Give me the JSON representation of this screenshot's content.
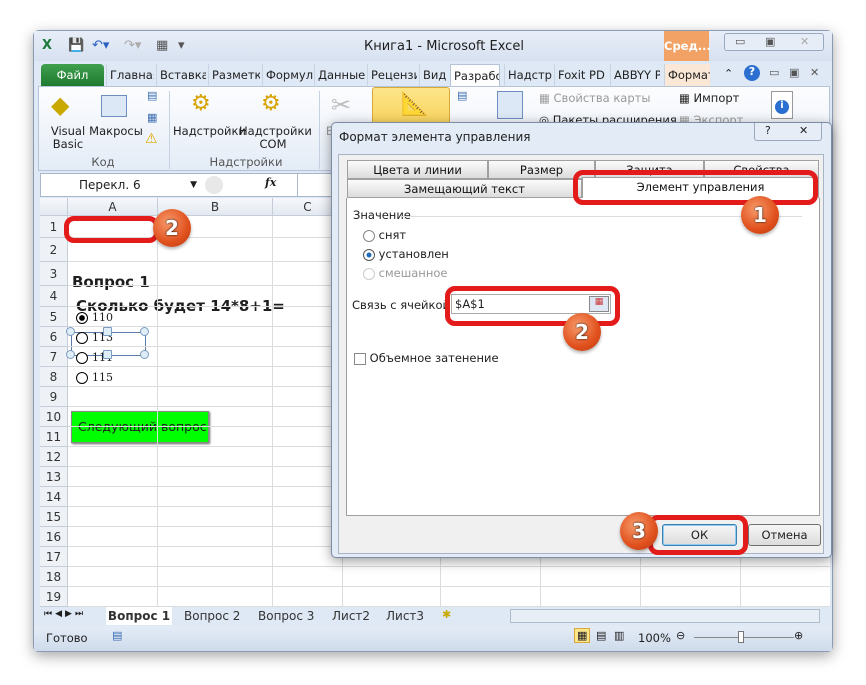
{
  "window": {
    "title": "Книга1  -  Microsoft Excel",
    "contextual_tab": "Сред...",
    "contextual_color": "#f1a264"
  },
  "ribbon_tabs": [
    "Файл",
    "Главная",
    "Вставка",
    "Разметк",
    "Формул",
    "Данные",
    "Рецензи",
    "Вид",
    "Разрабо",
    "Надстро",
    "Foxit PD",
    "ABBYY PI",
    "Формат"
  ],
  "active_tab": "Разрабо",
  "ribbon": {
    "code_group": {
      "label": "Код",
      "visual_basic": "Visual Basic",
      "macros": "Макросы"
    },
    "addins_group": {
      "label": "Надстройки",
      "addins": "Надстройки",
      "com_addins": "Надстройки COM"
    },
    "map_properties": "Свойства карты",
    "expansion_packs": "Пакеты расширения",
    "import": "Импорт",
    "export": "Экспорт",
    "insert_partial": "Вс"
  },
  "formula_bar": {
    "name_box": "Перекл. 6",
    "fx": "fx",
    "value": ""
  },
  "sheet": {
    "columns": [
      "A",
      "B",
      "C"
    ],
    "rows": [
      "1",
      "2",
      "3",
      "4",
      "5",
      "6",
      "7",
      "8",
      "9",
      "10",
      "11",
      "12",
      "13",
      "14",
      "15",
      "16",
      "17",
      "18",
      "19"
    ],
    "cells": {
      "A2": "Вопрос 1",
      "A3": "Сколько будет 14*8+1="
    },
    "options": [
      {
        "label": "110",
        "selected": true
      },
      {
        "label": "113",
        "selected": false
      },
      {
        "label": "111",
        "selected": false
      },
      {
        "label": "115",
        "selected": false
      }
    ],
    "next_button": "Следующий вопрос",
    "next_button_color": "#00ff00"
  },
  "sheet_tabs": [
    "Вопрос 1",
    "Вопрос 2",
    "Вопрос 3",
    "Лист2",
    "Лист3"
  ],
  "active_sheet": "Вопрос 1",
  "status": {
    "ready": "Готово",
    "zoom": "100%",
    "zoom_level": 100
  },
  "dialog": {
    "title": "Формат элемента управления",
    "tabs_row1": [
      "Цвета и линии",
      "Размер",
      "Защита",
      "Свойства"
    ],
    "tabs_row2": [
      "Замещающий текст",
      "Элемент управления"
    ],
    "active_tab": "Элемент управления",
    "value_group": "Значение",
    "radios": [
      {
        "label": "снят",
        "checked": false,
        "disabled": false
      },
      {
        "label": "установлен",
        "checked": true,
        "disabled": false
      },
      {
        "label": "смешанное",
        "checked": false,
        "disabled": true
      }
    ],
    "cell_link_label": "Связь с ячейкой:",
    "cell_link_value": "$A$1",
    "shading_label": "Объемное затенение",
    "shading_checked": false,
    "ok": "ОК",
    "cancel": "Отмена",
    "help": "?",
    "close": "✕"
  },
  "annotations": {
    "badge_1": "1",
    "badge_2a": "2",
    "badge_2b": "2",
    "badge_3": "3",
    "highlight_color": "#e41b1b"
  }
}
